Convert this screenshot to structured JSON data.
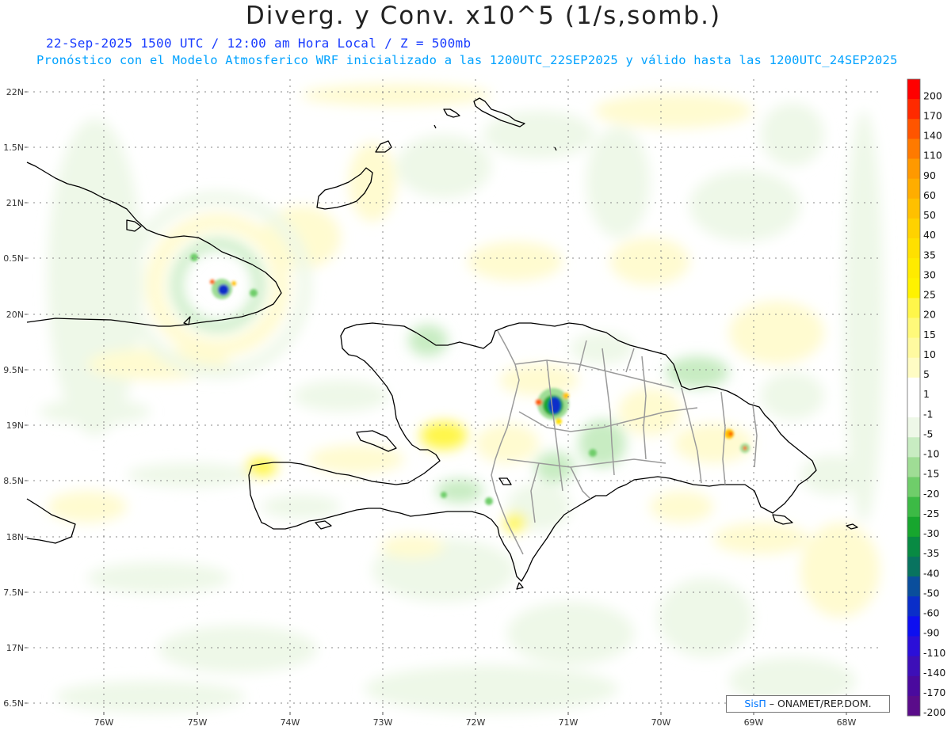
{
  "header": {
    "title": "Diverg. y Conv. x10^5 (1/s,somb.)",
    "subtitle": "22-Sep-2025 1500 UTC / 12:00 am Hora Local / Z = 500mb",
    "forecast_line": "Pronóstico con el Modelo Atmosferico WRF inicializado a las 1200UTC_22SEP2025 y válido hasta las  1200UTC_24SEP2025"
  },
  "map": {
    "lat_ticks": [
      "22N",
      "1.5N",
      "21N",
      "0.5N",
      "20N",
      "9.5N",
      "19N",
      "8.5N",
      "18N",
      "7.5N",
      "17N",
      "6.5N"
    ],
    "lon_ticks": [
      "76W",
      "75W",
      "74W",
      "73W",
      "72W",
      "71W",
      "70W",
      "69W",
      "68W"
    ]
  },
  "colorbar": {
    "levels": [
      "200",
      "170",
      "140",
      "110",
      "90",
      "60",
      "50",
      "40",
      "35",
      "30",
      "25",
      "20",
      "15",
      "10",
      "5",
      "1",
      "-1",
      "-5",
      "-10",
      "-15",
      "-20",
      "-25",
      "-30",
      "-35",
      "-40",
      "-50",
      "-60",
      "-90",
      "-110",
      "-140",
      "-170",
      "-200"
    ],
    "colors": [
      "#ff0000",
      "#ff2a00",
      "#ff5500",
      "#ff7a00",
      "#ff9900",
      "#ffad00",
      "#ffc000",
      "#ffd200",
      "#ffe000",
      "#ffeb00",
      "#fff200",
      "#fff64a",
      "#fff97a",
      "#fffaa0",
      "#fffcc4",
      "#ffffff",
      "#ffffff",
      "#eef8e8",
      "#c8ecc2",
      "#9fdd95",
      "#6fcd6a",
      "#3cba45",
      "#17a62e",
      "#088a43",
      "#08735f",
      "#0a4e9c",
      "#0a2ec9",
      "#0d0ff0",
      "#2b0fd8",
      "#3d0fb8",
      "#4a0a9e",
      "#5a0c8a"
    ]
  },
  "credit": {
    "brand": "SisΠ",
    "text": "– ONAMET/REP.DOM."
  }
}
